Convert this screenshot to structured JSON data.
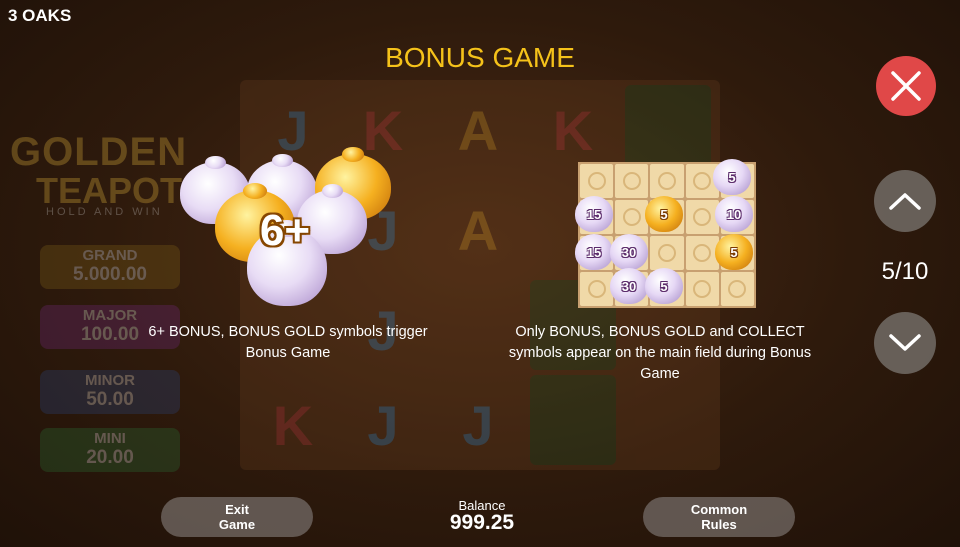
{
  "app": {
    "name": "3 OAKS"
  },
  "page": {
    "title": "BONUS GAME",
    "counter": "5/10"
  },
  "background": {
    "logo_line1": "GOLDEN",
    "logo_line2": "TEAPOT",
    "logo_tagline": "HOLD AND WIN",
    "jackpots": [
      {
        "name": "GRAND",
        "value": "5.000.00"
      },
      {
        "name": "MAJOR",
        "value": "100.00"
      },
      {
        "name": "MINOR",
        "value": "50.00"
      },
      {
        "name": "MINI",
        "value": "20.00"
      }
    ],
    "reel_letters": [
      "J",
      "K",
      "A",
      "K",
      "J",
      "A",
      "J",
      "J",
      "A",
      "K",
      "J",
      "J"
    ]
  },
  "sections": [
    {
      "image_label": "6+",
      "text": "6+ BONUS, BONUS GOLD symbols trigger Bonus Game"
    },
    {
      "text": "Only BONUS, BONUS GOLD and COLLECT symbols appear on the main field during Bonus Game"
    }
  ],
  "example_grid": {
    "pots": [
      {
        "value": "5",
        "kind": "white"
      },
      {
        "value": "15",
        "kind": "white"
      },
      {
        "value": "5",
        "kind": "gold"
      },
      {
        "value": "10",
        "kind": "white"
      },
      {
        "value": "15",
        "kind": "white"
      },
      {
        "value": "30",
        "kind": "white"
      },
      {
        "value": "5",
        "kind": "gold"
      },
      {
        "value": "30",
        "kind": "white"
      },
      {
        "value": "5",
        "kind": "white"
      }
    ]
  },
  "footer": {
    "exit_label": "Exit Game",
    "balance_label": "Balance",
    "balance_value": "999.25",
    "rules_label": "Common Rules"
  },
  "colors": {
    "title": "#f5c21a",
    "close_button": "#e04848",
    "nav_button": "#78736e"
  },
  "icons": {
    "close": "close-icon",
    "up": "chevron-up-icon",
    "down": "chevron-down-icon"
  }
}
